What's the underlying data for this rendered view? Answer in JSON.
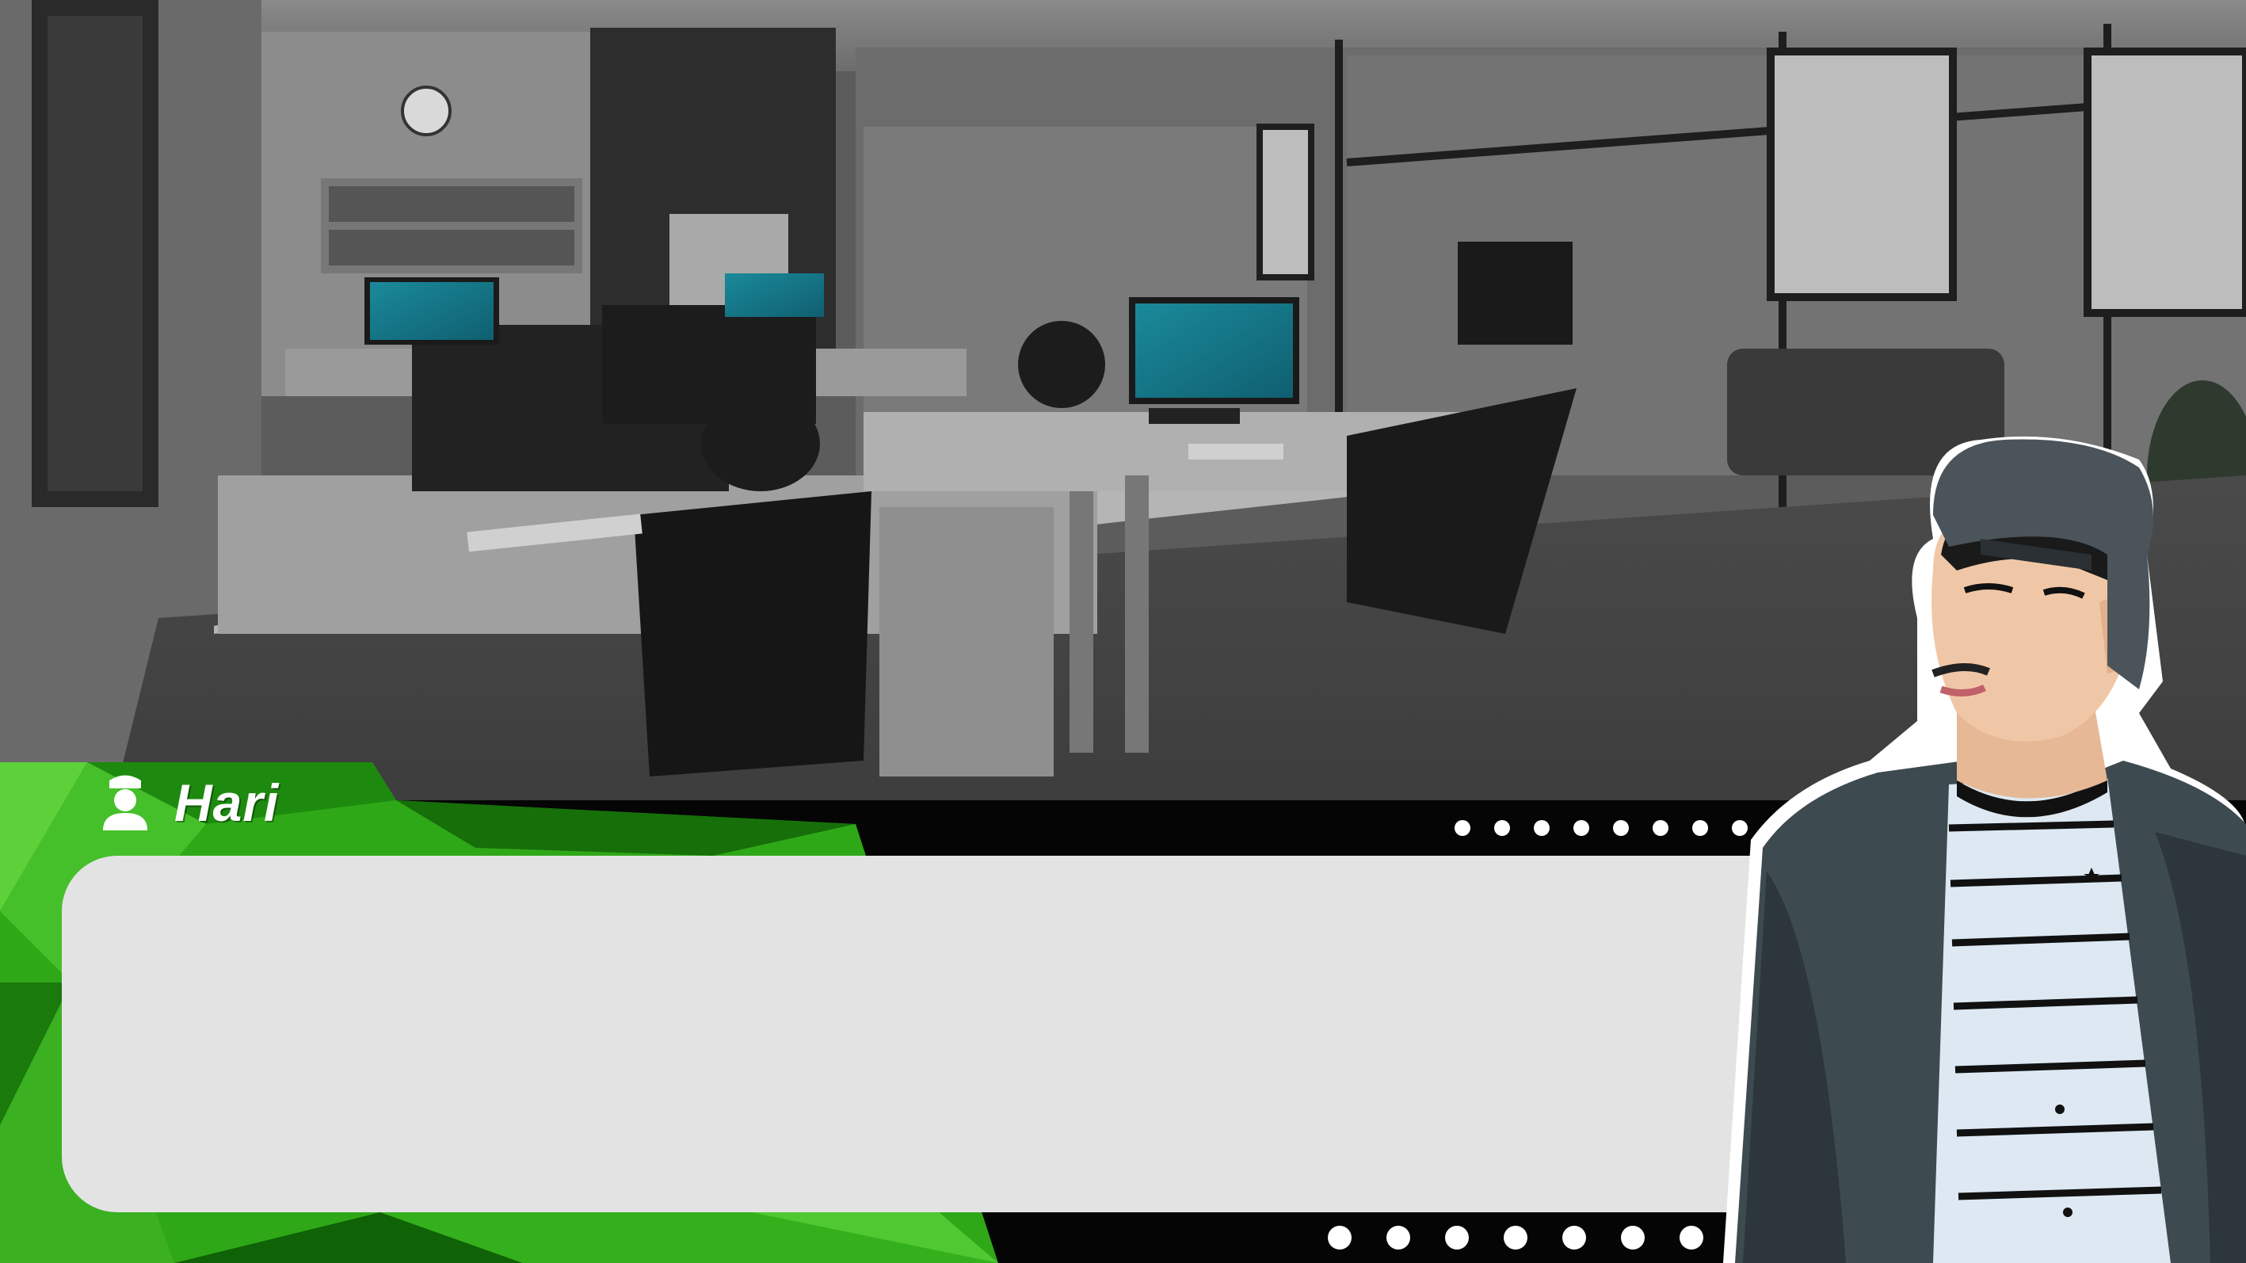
{
  "dialog": {
    "speaker_name": "Hari",
    "speaker_icon": "user-badge-icon",
    "text": ""
  },
  "colors": {
    "accent_green": "#33b31a",
    "dark_green": "#1a7a10",
    "dialog_box": "#e3e3e3",
    "dots": "#ffffff"
  },
  "scene": {
    "setting": "office-interior",
    "character_icon": "character-portrait"
  }
}
